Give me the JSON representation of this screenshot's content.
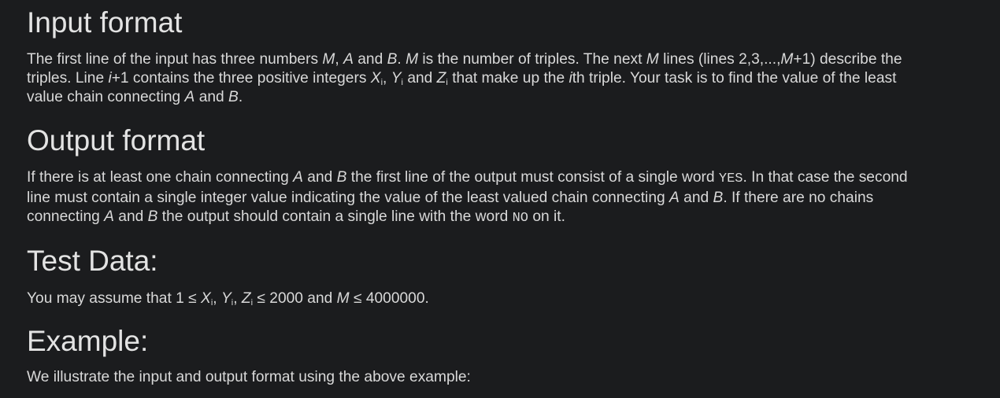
{
  "input_format": {
    "heading": "Input format",
    "t1": "The first line of the input has three numbers ",
    "M": "M",
    "t2": ", ",
    "A": "A",
    "t3": " and ",
    "B": "B",
    "t4": ". ",
    "M2": "M",
    "t5": " is the number of triples. The next ",
    "M3": "M",
    "t6": " lines (lines 2,3,...,",
    "M4": "M",
    "t7": "+1) describe the triples. Line ",
    "i": "i",
    "t8": "+1 contains the three positive integers ",
    "X": "X",
    "Xi": "i",
    "t9": ", ",
    "Y": "Y",
    "Yi": "i",
    "t10": " and ",
    "Z": "Z",
    "Zi": "i",
    "t11": " that make up the ",
    "i2": "i",
    "t12": "th triple. Your task is to find the value of the least value chain connecting ",
    "A2": "A",
    "t13": " and ",
    "B2": "B",
    "t14": "."
  },
  "output_format": {
    "heading": "Output format",
    "t1": "If there is at least one chain connecting ",
    "A": "A",
    "t2": " and ",
    "B": "B",
    "t3": " the first line of the output must consist of a single word ",
    "yes": "YES",
    "t4": ". In that case the second line must contain a single integer value indicating the value of the least valued chain connecting ",
    "A2": "A",
    "t5": " and ",
    "B2": "B",
    "t6": ". If there are no chains connecting ",
    "A3": "A",
    "t7": " and ",
    "B3": "B",
    "t8": " the output should contain a single line with the word ",
    "no": "NO",
    "t9": " on it."
  },
  "test_data": {
    "heading": "Test Data:",
    "t1": "You may assume that 1 ≤ ",
    "X": "X",
    "Xi": "i",
    "t2": ", ",
    "Y": "Y",
    "Yi": "i",
    "t3": ", ",
    "Z": "Z",
    "Zi": "i",
    "t4": " ≤ 2000 and ",
    "M": "M",
    "t5": " ≤ 4000000."
  },
  "example": {
    "heading": "Example:",
    "text": "We illustrate the input and output format using the above example:"
  }
}
